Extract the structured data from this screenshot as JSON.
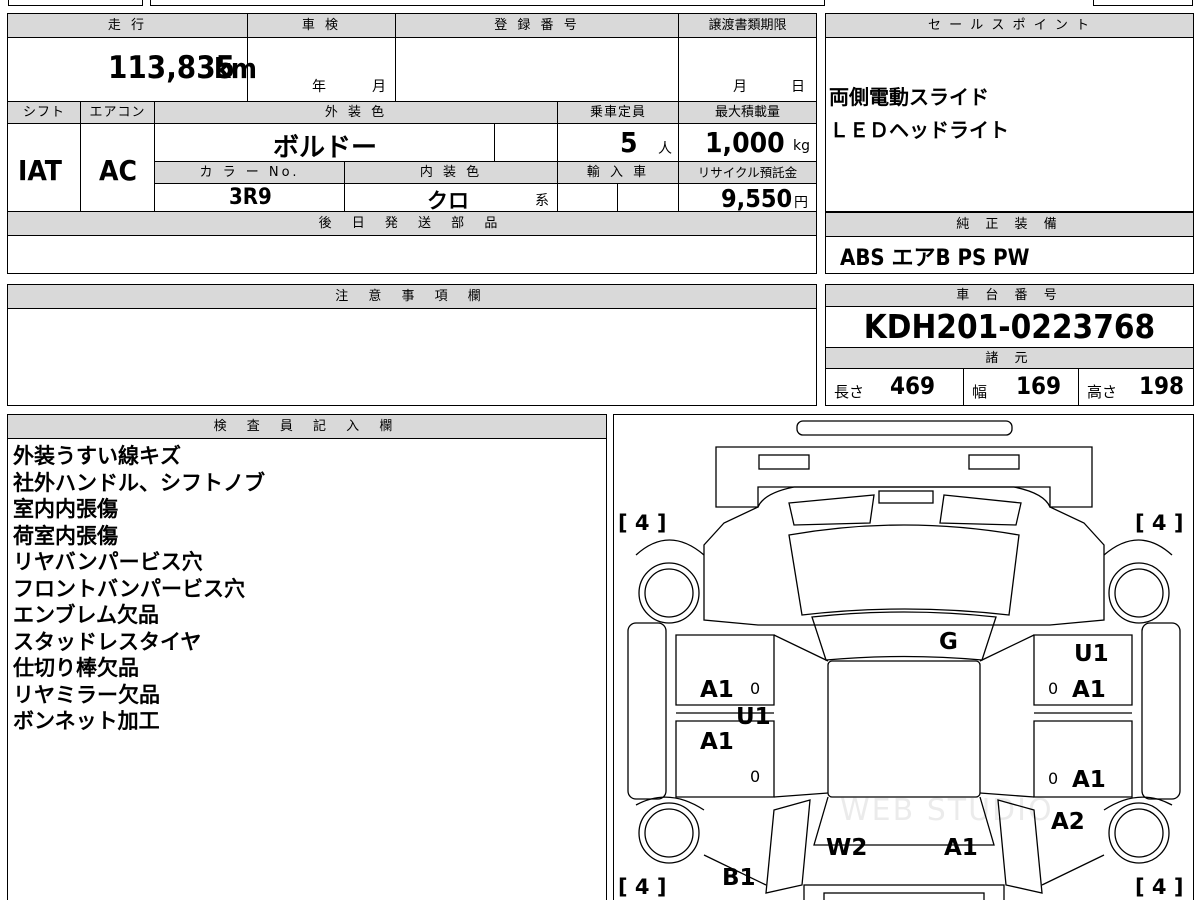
{
  "main": {
    "mileage_label": "走 行",
    "mileage_value": "113,835",
    "mileage_unit": "km",
    "shaken_label": "車 検",
    "shaken_year": "年",
    "shaken_month": "月",
    "reg_label": "登 録 番 号",
    "transfer_label": "譲渡書類期限",
    "transfer_month": "月",
    "transfer_day": "日",
    "shift_label": "シフト",
    "shift_value": "IAT",
    "ac_label": "エアコン",
    "ac_value": "AC",
    "exterior_label": "外 装 色",
    "exterior_value": "ボルドー",
    "capacity_label": "乗車定員",
    "capacity_value": "5",
    "capacity_unit": "人",
    "maxload_label": "最大積載量",
    "maxload_value": "1,000",
    "maxload_unit": "kg",
    "colorno_label": "カ ラ ー No.",
    "colorno_value": "3R9",
    "interior_label": "内 装 色",
    "interior_value": "クロ",
    "interior_unit": "系",
    "import_label": "輸 入 車",
    "recycle_label": "リサイクル預託金",
    "recycle_value": "9,550",
    "recycle_unit": "円",
    "later_label": "後 日 発 送 部 品"
  },
  "sales": {
    "label": "セ ー ル ス ポ イ ン ト",
    "points": [
      "両側電動スライド",
      "ＬＥＤヘッドライト"
    ]
  },
  "equipment": {
    "label": "純 正 装 備",
    "value": "ABS エアB PS PW"
  },
  "caution": {
    "label": "注 意 事 項 欄"
  },
  "chassis": {
    "label": "車 台 番 号",
    "value": "KDH201-0223768",
    "spec_label": "諸 元",
    "length_label": "長さ",
    "length_value": "469",
    "width_label": "幅",
    "width_value": "169",
    "height_label": "高さ",
    "height_value": "198"
  },
  "inspector": {
    "label": "検 査 員 記 入 欄",
    "notes": [
      "外装うすい線キズ",
      "社外ハンドル、シフトノブ",
      "室内内張傷",
      "荷室内張傷",
      "リヤバンパービス穴",
      "フロントバンパービス穴",
      "エンブレム欠品",
      "スタッドレスタイヤ",
      "仕切り棒欠品",
      "リヤミラー欠品",
      "ボンネット加工"
    ]
  },
  "diagram": {
    "tire_fl": "[ 4 ]",
    "tire_fr": "[ 4 ]",
    "tire_rl": "[ 4 ]",
    "tire_rr": "[ 4 ]",
    "marks": {
      "g": "G",
      "u1_right": "U1",
      "a1_right_front": "A1",
      "zero_right_front": "0",
      "a1_left_front": "A1",
      "zero_left_front": "0",
      "u1_left": "U1",
      "a1_left_rear": "A1",
      "zero_left_rear": "0",
      "zero_right_rear": "0",
      "a1_right_rear": "A1",
      "a2": "A2",
      "w2": "W2",
      "a1_back": "A1",
      "b1": "B1"
    },
    "watermark": "WEB STUDIO"
  }
}
